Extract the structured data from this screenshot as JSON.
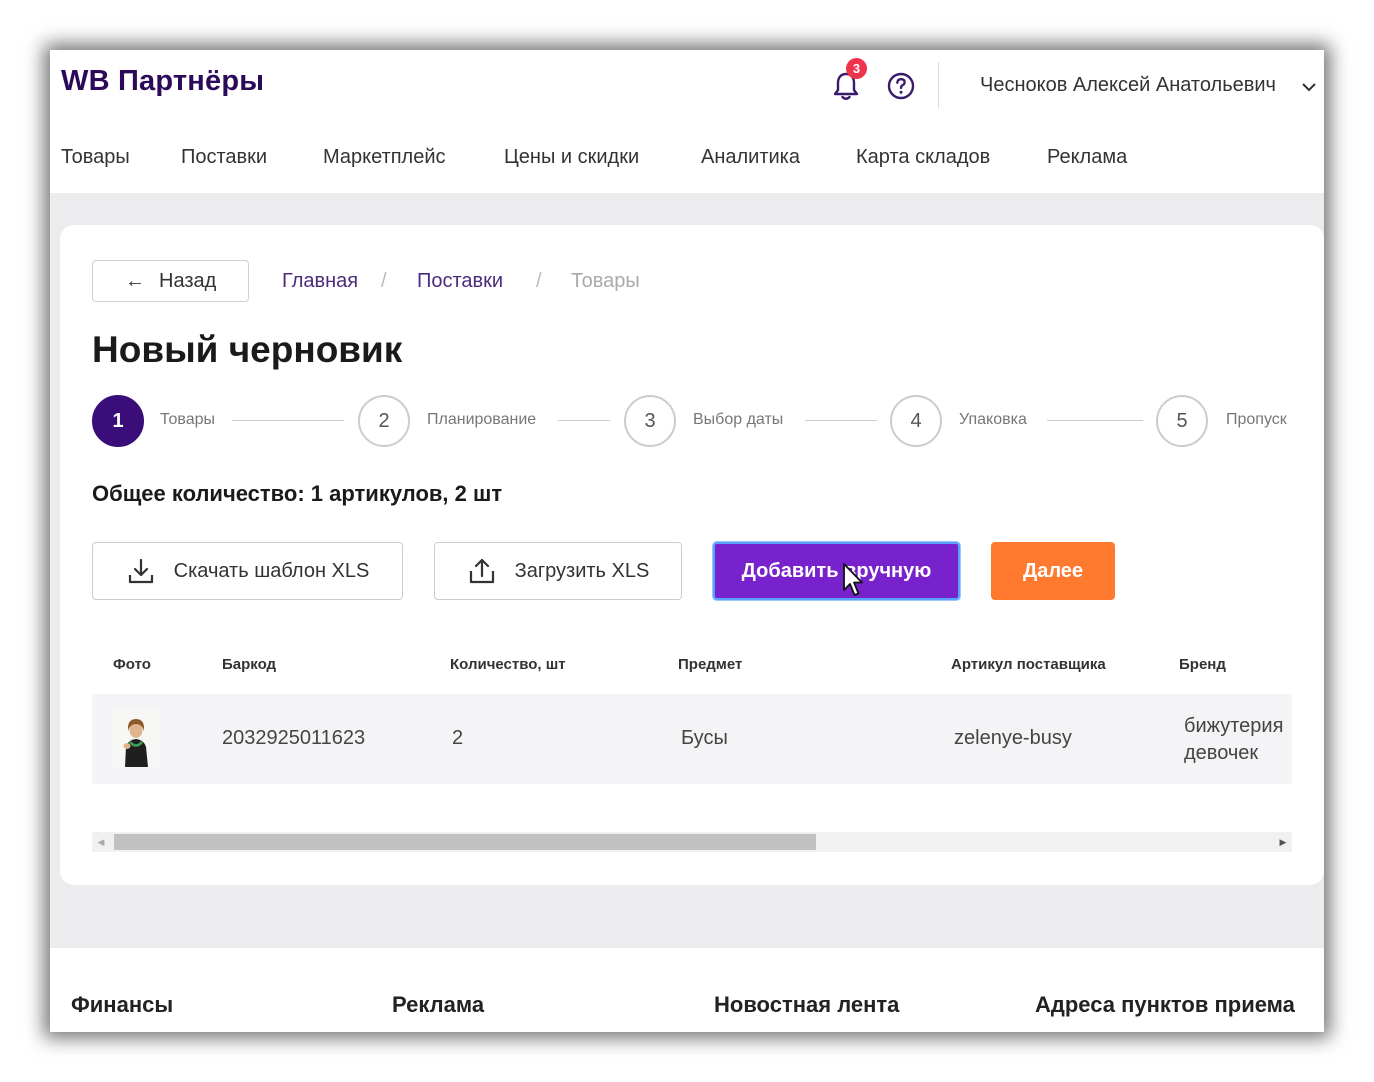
{
  "header": {
    "logo": "WB Партнёры",
    "notifications_count": "3",
    "user_name": "Чесноков Алексей Анатольевич"
  },
  "nav": [
    "Товары",
    "Поставки",
    "Маркетплейс",
    "Цены и скидки",
    "Аналитика",
    "Карта складов",
    "Реклама"
  ],
  "breadcrumb": {
    "back_label": "Назад",
    "items": [
      "Главная",
      "Поставки",
      "Товары"
    ],
    "separator": "/"
  },
  "page_title": "Новый черновик",
  "stepper": {
    "active_step": 1,
    "steps": [
      {
        "num": "1",
        "label": "Товары"
      },
      {
        "num": "2",
        "label": "Планирование"
      },
      {
        "num": "3",
        "label": "Выбор даты"
      },
      {
        "num": "4",
        "label": "Упаковка"
      },
      {
        "num": "5",
        "label": "Пропуск"
      }
    ]
  },
  "total": "Общее количество: 1 артикулов, 2 шт",
  "actions": {
    "download_template": "Скачать шаблон XLS",
    "upload": "Загрузить XLS",
    "add_manual": "Добавить вручную",
    "next": "Далее"
  },
  "table": {
    "columns": [
      "Фото",
      "Баркод",
      "Количество, шт",
      "Предмет",
      "Артикул поставщика",
      "Бренд"
    ],
    "rows": [
      {
        "barcode": "2032925011623",
        "quantity": "2",
        "subject": "Бусы",
        "vendor_code": "zelenye-busy",
        "brand_line1": "бижутерия",
        "brand_line2": "девочек"
      }
    ],
    "horizontal_scroll_position": 0.0
  },
  "footer": [
    "Финансы",
    "Реклама",
    "Новостная лента",
    "Адреса пунктов приема"
  ],
  "colors": {
    "logo": "#2c0a5a",
    "active_step": "#3b0d78",
    "primary_button": "#7722cc",
    "next_button": "#ff7a2f",
    "badge": "#f0344b",
    "breadcrumb_link": "#4b2c7c"
  }
}
